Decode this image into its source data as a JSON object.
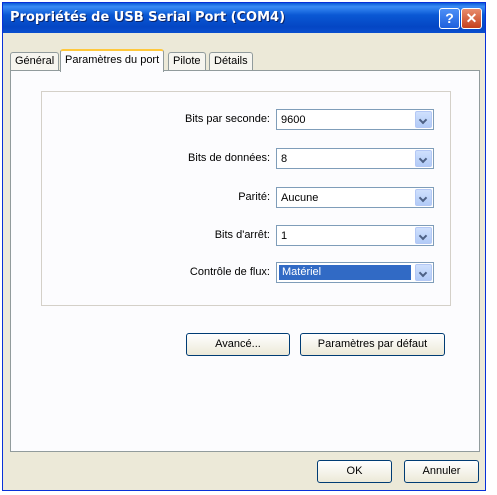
{
  "window": {
    "title": "Propriétés de USB Serial Port (COM4)"
  },
  "titlebar": {
    "help_glyph": "?",
    "close_glyph": "✕"
  },
  "tabs": [
    {
      "label": "Général"
    },
    {
      "label": "Paramètres du port"
    },
    {
      "label": "Pilote"
    },
    {
      "label": "Détails"
    }
  ],
  "settings": {
    "bits_per_second": {
      "label": "Bits par seconde:",
      "value": "9600"
    },
    "data_bits": {
      "label": "Bits de données:",
      "value": "8"
    },
    "parity": {
      "label": "Parité:",
      "value": "Aucune"
    },
    "stop_bits": {
      "label": "Bits d'arrêt:",
      "value": "1"
    },
    "flow_control": {
      "label": "Contrôle de flux:",
      "value": "Matériel"
    }
  },
  "buttons": {
    "advanced": "Avancé...",
    "defaults": "Paramètres par défaut",
    "ok": "OK",
    "cancel": "Annuler"
  },
  "colors": {
    "titlebar": "#0a58d4",
    "selection": "#316ac5",
    "tab_highlight": "#ffc83c"
  }
}
